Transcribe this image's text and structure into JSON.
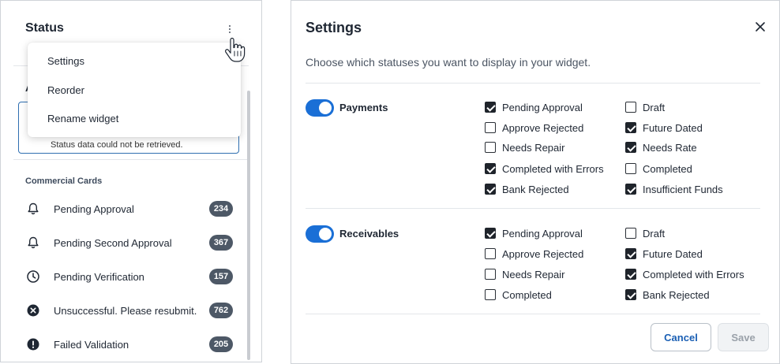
{
  "widget": {
    "title": "Status",
    "peek_letter": "A",
    "alert_text": "Status data could not be retrieved.",
    "section_label": "Commercial Cards",
    "items": [
      {
        "label": "Pending Approval",
        "count": "234",
        "icon": "bell-icon"
      },
      {
        "label": "Pending Second Approval",
        "count": "367",
        "icon": "bell-icon"
      },
      {
        "label": "Pending Verification",
        "count": "157",
        "icon": "clock-icon"
      },
      {
        "label": "Unsuccessful. Please resubmit.",
        "count": "762",
        "icon": "x-circle-icon"
      },
      {
        "label": "Failed Validation",
        "count": "205",
        "icon": "exclamation-circle-icon"
      }
    ],
    "menu": [
      "Settings",
      "Reorder",
      "Rename widget"
    ]
  },
  "dialog": {
    "title": "Settings",
    "subtitle": "Choose which statuses you want to display in your widget.",
    "groups": [
      {
        "name": "Payments",
        "enabled": true,
        "col1": [
          {
            "label": "Pending Approval",
            "checked": true
          },
          {
            "label": "Approve Rejected",
            "checked": false
          },
          {
            "label": "Needs Repair",
            "checked": false
          },
          {
            "label": "Completed with Errors",
            "checked": true
          },
          {
            "label": "Bank Rejected",
            "checked": true
          }
        ],
        "col2": [
          {
            "label": "Draft",
            "checked": false
          },
          {
            "label": "Future Dated",
            "checked": true
          },
          {
            "label": "Needs Rate",
            "checked": true
          },
          {
            "label": "Completed",
            "checked": false
          },
          {
            "label": "Insufficient Funds",
            "checked": true
          }
        ]
      },
      {
        "name": "Receivables",
        "enabled": true,
        "col1": [
          {
            "label": "Pending Approval",
            "checked": true
          },
          {
            "label": "Approve Rejected",
            "checked": false
          },
          {
            "label": "Needs Repair",
            "checked": false
          },
          {
            "label": "Completed",
            "checked": false
          }
        ],
        "col2": [
          {
            "label": "Draft",
            "checked": false
          },
          {
            "label": "Future Dated",
            "checked": true
          },
          {
            "label": "Completed with Errors",
            "checked": true
          },
          {
            "label": "Bank Rejected",
            "checked": true
          }
        ]
      }
    ],
    "cancel_label": "Cancel",
    "save_label": "Save"
  },
  "colors": {
    "accent": "#1a6fd6",
    "badge": "#4d5866",
    "alert_border": "#2f6fb1"
  }
}
